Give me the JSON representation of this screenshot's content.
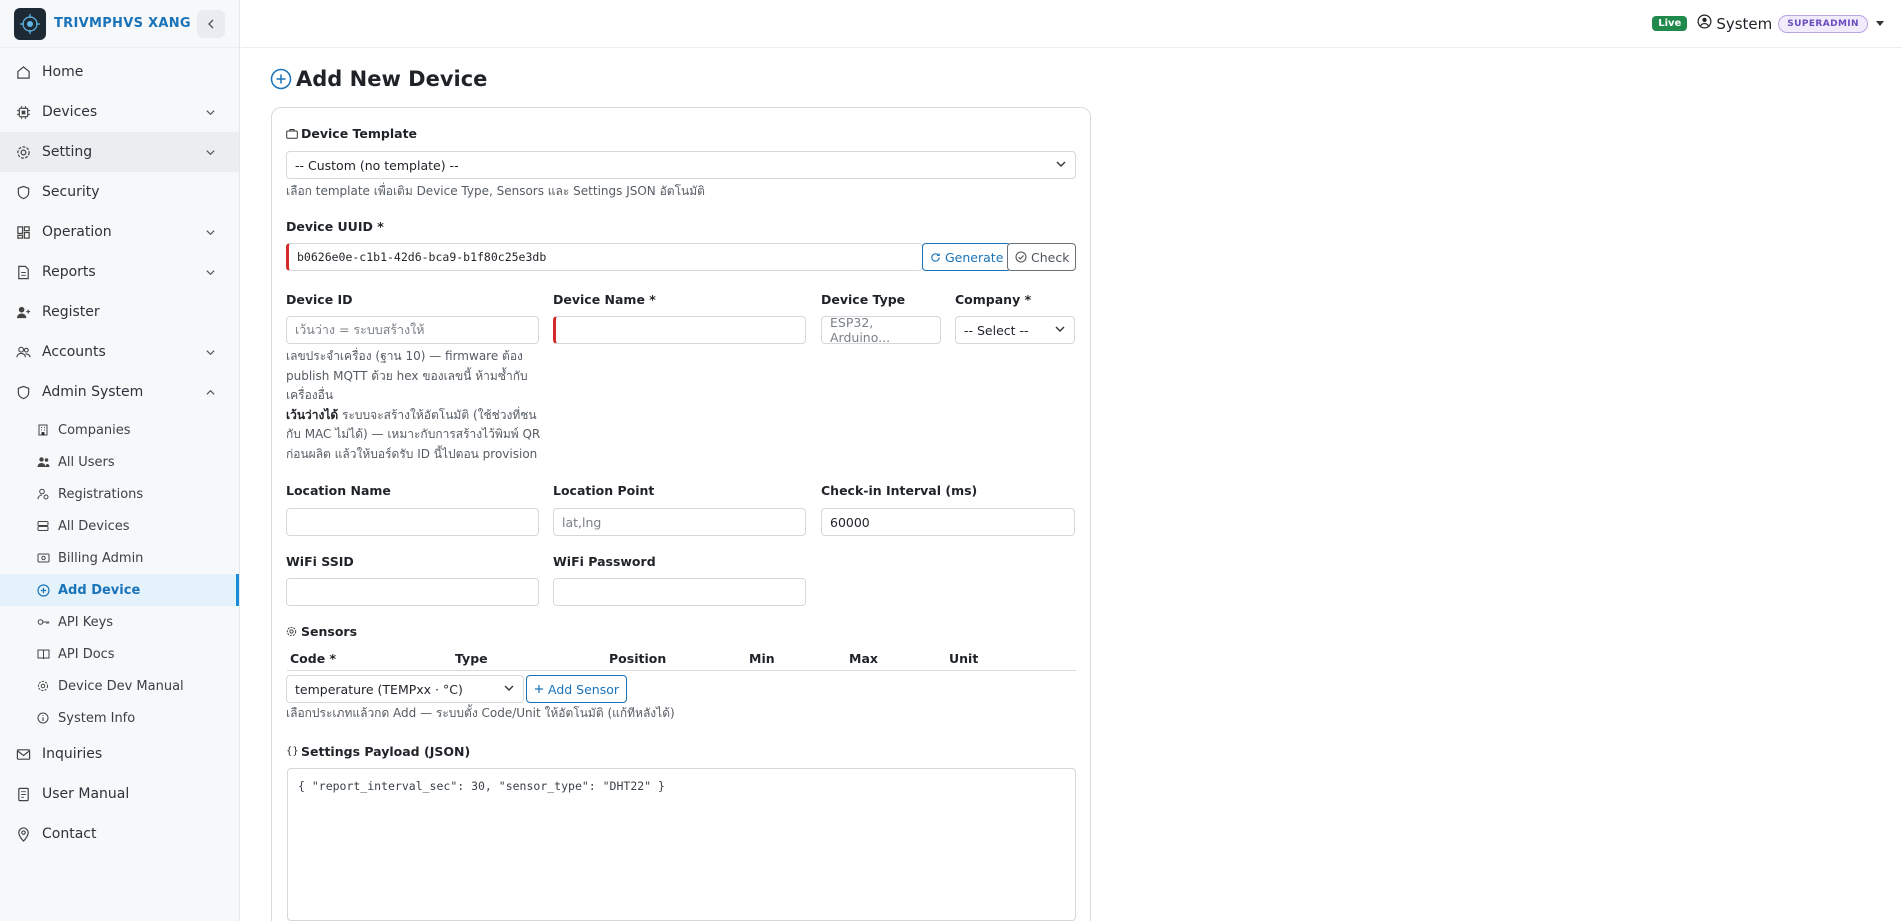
{
  "brand": {
    "name": "TRIVMPHVS XANG"
  },
  "topbar": {
    "live": "Live",
    "user": "System",
    "role": "SUPERADMIN"
  },
  "sidebar": {
    "items": [
      {
        "label": "Home",
        "icon": "home-icon"
      },
      {
        "label": "Devices",
        "icon": "chip-icon",
        "expandable": true
      },
      {
        "label": "Setting",
        "icon": "gear-icon",
        "expandable": true
      },
      {
        "label": "Security",
        "icon": "shield-icon"
      },
      {
        "label": "Operation",
        "icon": "dashboard-icon",
        "expandable": true
      },
      {
        "label": "Reports",
        "icon": "report-icon",
        "expandable": true
      },
      {
        "label": "Register",
        "icon": "user-plus-icon"
      },
      {
        "label": "Accounts",
        "icon": "users-icon",
        "expandable": true
      },
      {
        "label": "Admin System",
        "icon": "shield-icon",
        "expanded": true
      }
    ],
    "admin_sub": [
      {
        "label": "Companies",
        "icon": "building-icon"
      },
      {
        "label": "All Users",
        "icon": "users-icon"
      },
      {
        "label": "Registrations",
        "icon": "user-cog-icon"
      },
      {
        "label": "All Devices",
        "icon": "server-icon"
      },
      {
        "label": "Billing Admin",
        "icon": "billing-icon"
      },
      {
        "label": "Add Device",
        "icon": "plus-circle-icon",
        "active": true
      },
      {
        "label": "API Keys",
        "icon": "key-icon"
      },
      {
        "label": "API Docs",
        "icon": "book-icon"
      },
      {
        "label": "Device Dev Manual",
        "icon": "gear-icon"
      },
      {
        "label": "System Info",
        "icon": "info-icon"
      }
    ],
    "bottom": [
      {
        "label": "Inquiries",
        "icon": "mail-icon"
      },
      {
        "label": "User Manual",
        "icon": "manual-icon"
      },
      {
        "label": "Contact",
        "icon": "pin-icon"
      }
    ]
  },
  "page": {
    "title": "Add New Device"
  },
  "form": {
    "template": {
      "label": "Device Template",
      "value": "-- Custom (no template) --",
      "help": "เลือก template เพื่อเติม Device Type, Sensors และ Settings JSON อัตโนมัติ"
    },
    "uuid": {
      "label": "Device UUID *",
      "value": "b0626e0e-c1b1-42d6-bca9-b1f80c25e3db",
      "generate": "Generate",
      "check": "Check"
    },
    "device_id": {
      "label": "Device ID",
      "placeholder": "เว้นว่าง = ระบบสร้างให้",
      "help1": "เลขประจำเครื่อง (ฐาน 10) — firmware ต้อง publish MQTT ด้วย hex ของเลขนี้ ห้ามซ้ำกับเครื่องอื่น",
      "help2_bold": "เว้นว่างได้",
      "help2": " ระบบจะสร้างให้อัตโนมัติ (ใช้ช่วงที่ชนกับ MAC ไม่ได้) — เหมาะกับการสร้างไว้พิมพ์ QR ก่อนผลิต แล้วให้บอร์ดรับ ID นี้ไปตอน provision"
    },
    "device_name": {
      "label": "Device Name *",
      "value": ""
    },
    "device_type": {
      "label": "Device Type",
      "placeholder": "ESP32, Arduino..."
    },
    "company": {
      "label": "Company *",
      "value": "-- Select --"
    },
    "location_name": {
      "label": "Location Name",
      "value": ""
    },
    "location_point": {
      "label": "Location Point",
      "placeholder": "lat,lng"
    },
    "checkin": {
      "label": "Check-in Interval (ms)",
      "value": "60000"
    },
    "wifi_ssid": {
      "label": "WiFi SSID",
      "value": ""
    },
    "wifi_password": {
      "label": "WiFi Password",
      "value": ""
    },
    "sensors": {
      "label": "Sensors",
      "columns": [
        "Code *",
        "Type",
        "Position",
        "Min",
        "Max",
        "Unit"
      ],
      "select_value": "temperature (TEMPxx · °C)",
      "add": "Add Sensor",
      "help": "เลือกประเภทแล้วกด Add — ระบบตั้ง Code/Unit ให้อัตโนมัติ (แก้ทีหลังได้)"
    },
    "settings": {
      "label": "Settings Payload (JSON)",
      "value": "{ \"report_interval_sec\": 30, \"sensor_type\": \"DHT22\" }"
    }
  }
}
